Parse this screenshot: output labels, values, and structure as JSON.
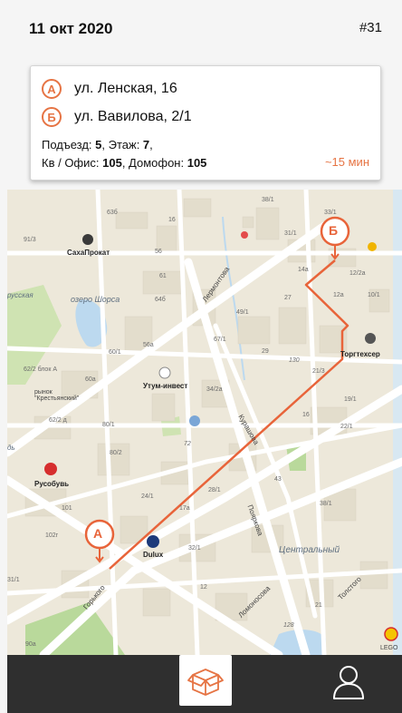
{
  "header": {
    "date": "11 окт 2020",
    "order_number": "#31"
  },
  "order": {
    "point_a": {
      "badge": "А",
      "address": "ул. Ленская, 16"
    },
    "point_b": {
      "badge": "Б",
      "address": "ул. Вавилова, 2/1"
    },
    "details": {
      "entrance_label": "Подъезд: ",
      "entrance": "5",
      "floor_label": ", Этаж: ",
      "floor": "7",
      "floor_end": ",",
      "apt_label": "Кв / Офис: ",
      "apt": "105",
      "intercom_label": ", Домофон: ",
      "intercom": "105"
    },
    "eta": "~15 мин"
  },
  "map": {
    "markers": {
      "a": "А",
      "b": "Б"
    },
    "places": {
      "sakhaprokat": "СахаПрокат",
      "lake": "озеро Шорса",
      "russkaya": "русская",
      "market": "рынок \"Крестьянский\"",
      "utum": "Утум-инвест",
      "rusobuv": "Русобувь",
      "dulux": "Dulux",
      "torgtekhserv": "Торгтехсер",
      "central": "Центральный",
      "lego": "LEGO",
      "d": "дь"
    },
    "streets": {
      "lermontova": "Лермонтова",
      "kurashova": "Курашова",
      "gorkogo": "Горького",
      "poyarkova": "Пояркова",
      "lomonosova": "Ломоносова",
      "tolstogo": "Толстого"
    },
    "house_numbers": {
      "n636": "63б",
      "n381": "38/1",
      "n311": "31/1",
      "n331": "33/1",
      "n911": "91/3",
      "n16a": "16",
      "n56": "56",
      "n61": "61",
      "n64b": "64б",
      "n14a": "14а",
      "n122a": "12/2а",
      "n12a": "12а",
      "n101": "10/1",
      "n491": "49/1",
      "n27": "27",
      "n671": "67/1",
      "n601": "60/1",
      "n56a": "56а",
      "n29": "29",
      "n130": "130",
      "n211": "21/3",
      "n622a": "62/2 блок А",
      "n60a": "60а",
      "n342a": "34/2а",
      "n16": "16",
      "n622d": "62/2 д",
      "n72": "72",
      "n191": "19/1",
      "n221": "22/1",
      "n801": "80/1",
      "n802": "80/2",
      "n241": "24/1",
      "n281": "28/1",
      "n17a": "17а",
      "n101r": "101",
      "n102g": "102г",
      "n321": "32/1",
      "n43": "43",
      "n381b": "38/1",
      "n12": "12",
      "n21": "21",
      "n128": "128",
      "n90a": "90а",
      "n311b": "31/1"
    }
  },
  "nav": {
    "orders_icon": "box-icon",
    "profile_icon": "user-icon"
  }
}
